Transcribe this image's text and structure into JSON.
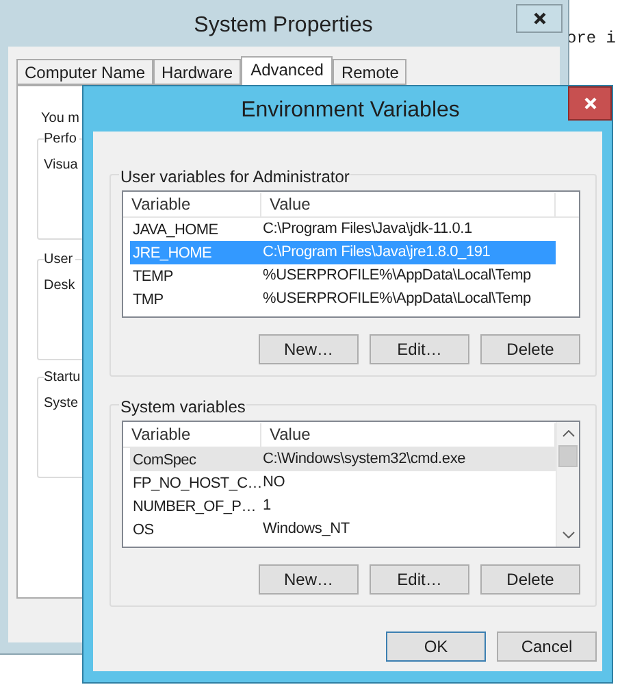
{
  "background_text": "ore i",
  "system_properties": {
    "title": "System Properties",
    "tabs": [
      {
        "label": "Computer Name",
        "selected": false
      },
      {
        "label": "Hardware",
        "selected": false
      },
      {
        "label": "Advanced",
        "selected": true
      },
      {
        "label": "Remote",
        "selected": false
      }
    ],
    "panel": {
      "intro": "You m",
      "groups": [
        {
          "legend": "Perfo",
          "text": "Visua"
        },
        {
          "legend": "User",
          "text": "Desk"
        },
        {
          "legend": "Startu",
          "text": "Syste"
        }
      ]
    }
  },
  "environment_variables": {
    "title": "Environment Variables",
    "sections": [
      {
        "legend": "User variables for Administrator",
        "columns": [
          "Variable",
          "Value"
        ],
        "focused": true,
        "scrollbar": false,
        "rows": [
          {
            "variable": "JAVA_HOME",
            "value": "C:\\Program Files\\Java\\jdk-11.0.1",
            "selected": false
          },
          {
            "variable": "JRE_HOME",
            "value": "C:\\Program Files\\Java\\jre1.8.0_191",
            "selected": true
          },
          {
            "variable": "TEMP",
            "value": "%USERPROFILE%\\AppData\\Local\\Temp",
            "selected": false
          },
          {
            "variable": "TMP",
            "value": "%USERPROFILE%\\AppData\\Local\\Temp",
            "selected": false
          }
        ],
        "buttons": [
          "New…",
          "Edit…",
          "Delete"
        ]
      },
      {
        "legend": "System variables",
        "columns": [
          "Variable",
          "Value"
        ],
        "focused": false,
        "scrollbar": true,
        "rows": [
          {
            "variable": "ComSpec",
            "value": "C:\\Windows\\system32\\cmd.exe",
            "selected": true
          },
          {
            "variable": "FP_NO_HOST_C…",
            "value": "NO",
            "selected": false
          },
          {
            "variable": "NUMBER_OF_P…",
            "value": "1",
            "selected": false
          },
          {
            "variable": "OS",
            "value": "Windows_NT",
            "selected": false
          }
        ],
        "buttons": [
          "New…",
          "Edit…",
          "Delete"
        ]
      }
    ],
    "buttons": [
      {
        "label": "OK",
        "default": true
      },
      {
        "label": "Cancel",
        "default": false
      }
    ]
  }
}
